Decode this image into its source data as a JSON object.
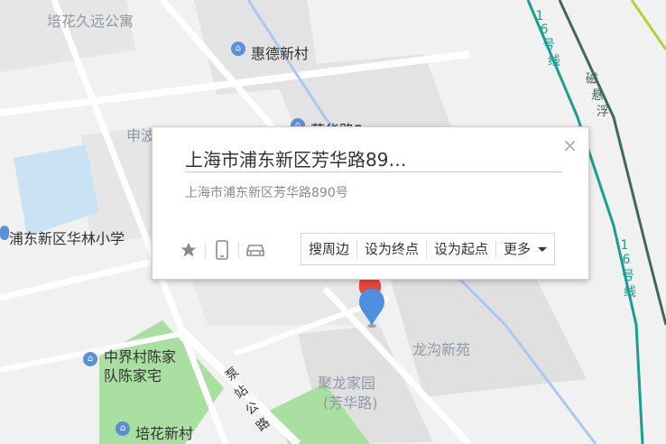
{
  "map_labels": {
    "top_community": "培花久远公寓",
    "huide_village": "惠德新村",
    "shenbo_partial": "申波",
    "hidden_road_partial": "芳华路5…",
    "school": "浦东新区华林小学",
    "longgou": "龙沟新苑",
    "julong_line1": "聚龙家园",
    "julong_line2": "(芳华路)",
    "zhongjie_line1": "中界村陈家",
    "zhongjie_line2": "队陈家宅",
    "peihua_village": "培花新村",
    "bengzhan_road": [
      "泵",
      "站",
      "公",
      "路"
    ],
    "line16_top": [
      "1",
      "6",
      "号",
      "线"
    ],
    "line16_bottom": [
      "1",
      "6",
      "号",
      "线"
    ],
    "maglev": [
      "磁",
      "悬",
      "浮"
    ]
  },
  "popup": {
    "title": "上海市浦东新区芳华路89…",
    "address": "上海市浦东新区芳华路890号",
    "close_label": "×",
    "actions": {
      "nearby": "搜周边",
      "set_destination": "设为终点",
      "set_origin": "设为起点",
      "more": "更多"
    }
  },
  "colors": {
    "water": "#c9e3f5",
    "green": "#a9dfa0",
    "metro_teal": "#1a9e8f",
    "maglev_dark": "#3f6a5b",
    "marker_blue": "#4d90e0",
    "marker_red": "#e6473a"
  }
}
